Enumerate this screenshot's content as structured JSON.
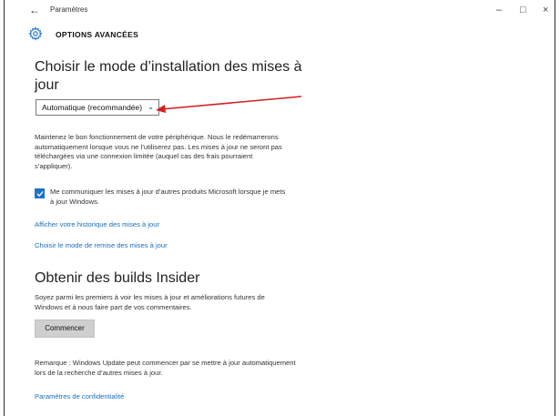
{
  "window": {
    "back_glyph": "←",
    "title": "Paramètres",
    "minimize_glyph": "–",
    "maximize_glyph": "□",
    "close_glyph": "×"
  },
  "header": {
    "icon": "gear-icon",
    "title": "OPTIONS AVANCÉES"
  },
  "install_section": {
    "heading": "Choisir le mode d’installation des mises à jour",
    "dropdown_value": "Automatique (recommandée)",
    "description": "Maintenez le bon fonctionnement de votre périphérique. Nous le redémarrerons automatiquement lorsque vous ne l’utiliserez pas. Les mises à jour ne seront pas téléchargées via une connexion limitée (auquel cas des frais pourraient s’appliquer).",
    "checkbox_checked": true,
    "checkbox_label": "Me communiquer les mises à jour d’autres produits Microsoft lorsque je mets à jour Windows.",
    "link_history": "Afficher votre historique des mises à jour",
    "link_delivery": "Choisir le mode de remise des mises à jour"
  },
  "insider_section": {
    "heading": "Obtenir des builds Insider",
    "description": "Soyez parmi les premiers à voir les mises à jour et améliorations futures de Windows et à nous faire part de vos commentaires.",
    "button_label": "Commencer",
    "note": "Remarque : Windows Update peut commencer par se mettre à jour automatiquement lors de la recherche d’autres mises à jour.",
    "link_privacy": "Paramètres de confidentialité"
  },
  "colors": {
    "accent": "#1a73c9",
    "annotation_arrow": "#d42020"
  }
}
